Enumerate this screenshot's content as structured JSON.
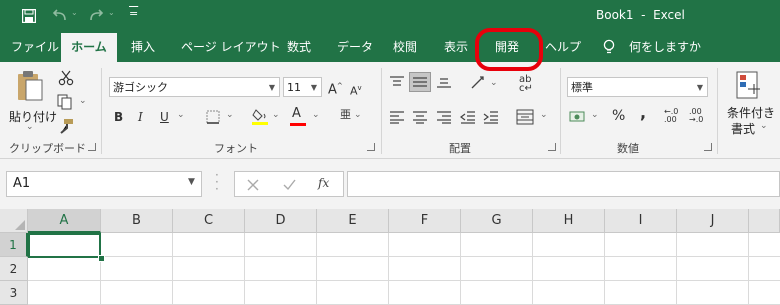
{
  "window": {
    "title": "Book1  -  Excel"
  },
  "qat": {
    "customize_glyph": "="
  },
  "tabs": [
    {
      "label": "ファイル"
    },
    {
      "label": "ホーム"
    },
    {
      "label": "挿入"
    },
    {
      "label": "ページ レイアウト"
    },
    {
      "label": "数式"
    },
    {
      "label": "データ"
    },
    {
      "label": "校閲"
    },
    {
      "label": "表示"
    },
    {
      "label": "開発"
    },
    {
      "label": "ヘルプ"
    }
  ],
  "tell_me": {
    "label": "何をしますか"
  },
  "highlight_color": "#e8000b",
  "accent_color": "#217346",
  "clipboard": {
    "paste_label": "貼り付け",
    "group_label": "クリップボード"
  },
  "font": {
    "name": "游ゴシック",
    "size": "11",
    "group_label": "フォント",
    "bold": "B",
    "italic": "I",
    "underline": "U",
    "highlight_swatch": "#ffff00",
    "font_color_swatch": "#ff0000"
  },
  "alignment": {
    "group_label": "配置"
  },
  "number": {
    "format": "標準",
    "group_label": "数値",
    "percent": "%",
    "comma": ","
  },
  "styles": {
    "conditional_line1": "条件付き",
    "conditional_line2": "書式"
  },
  "formula_bar": {
    "name_box": "A1",
    "fx": "fx"
  },
  "sheet": {
    "columns": [
      "A",
      "B",
      "C",
      "D",
      "E",
      "F",
      "G",
      "H",
      "I",
      "J"
    ],
    "rows": [
      "1",
      "2",
      "3"
    ]
  }
}
